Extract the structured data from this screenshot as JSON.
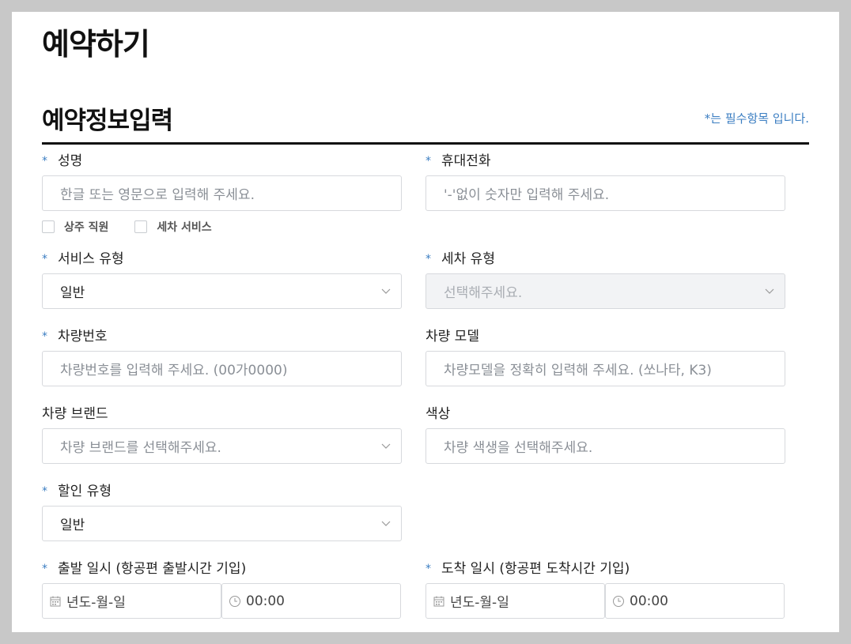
{
  "page": {
    "title": "예약하기",
    "section_title": "예약정보입력",
    "required_note": "*는 필수항목 입니다."
  },
  "required_mark": "*",
  "fields": {
    "name": {
      "label": "성명",
      "placeholder": "한글 또는 영문으로 입력해 주세요."
    },
    "phone": {
      "label": "휴대전화",
      "placeholder": "'-'없이 숫자만 입력해 주세요."
    },
    "service_type": {
      "label": "서비스 유형",
      "value": "일반"
    },
    "wash_type": {
      "label": "세차 유형",
      "value": "선택해주세요."
    },
    "car_number": {
      "label": "차량번호",
      "placeholder": "차량번호를 입력해 주세요. (00가0000)"
    },
    "car_model": {
      "label": "차량 모델",
      "placeholder": "차량모델을 정확히 입력해 주세요. (쏘나타, K3)"
    },
    "car_brand": {
      "label": "차량 브랜드",
      "value": "차량 브랜드를 선택해주세요."
    },
    "color": {
      "label": "색상",
      "placeholder": "차량 색생을 선택해주세요."
    },
    "discount_type": {
      "label": "할인 유형",
      "value": "일반"
    },
    "departure": {
      "label": "출발 일시 (항공편 출발시간 기입)",
      "date": "년도-월-일",
      "time": "00:00"
    },
    "arrival": {
      "label": "도착 일시 (항공편 도착시간 기입)",
      "date": "년도-월-일",
      "time": "00:00"
    }
  },
  "checkboxes": {
    "resident_staff": "상주 직원",
    "wash_service": "세차 서비스"
  },
  "colors": {
    "accent": "#3b7ec2",
    "border": "#d7d9dd",
    "disabled_bg": "#f2f3f5"
  },
  "icons": [
    "chevron-down-icon",
    "calendar-icon",
    "clock-icon"
  ]
}
